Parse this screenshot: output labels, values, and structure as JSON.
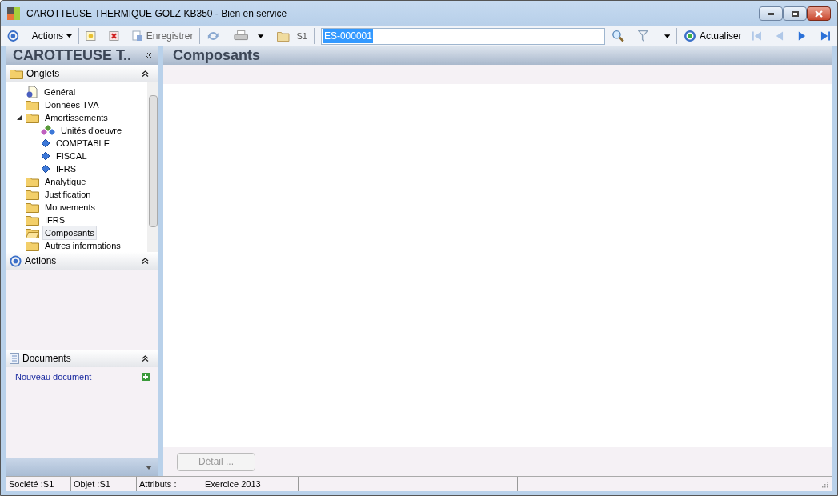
{
  "window": {
    "title": "CAROTTEUSE THERMIQUE GOLZ KB350 -  Bien en service"
  },
  "toolbar": {
    "actions": "Actions",
    "save": "Enregistrer",
    "folder": "S1",
    "search_value": "ES-000001",
    "refresh": "Actualiser"
  },
  "sidebar": {
    "title": "CAROTTEUSE T..",
    "tabs_panel": {
      "title": "Onglets",
      "expanded": true,
      "items": [
        {
          "label": "Général",
          "kind": "page",
          "selected": false
        },
        {
          "label": "Données TVA",
          "kind": "folder",
          "selected": false
        },
        {
          "label": "Amortissements",
          "kind": "folder",
          "selected": false,
          "expanded": true,
          "children": [
            {
              "label": "Unités d'oeuvre",
              "kind": "multi",
              "selected": false
            },
            {
              "label": "COMPTABLE",
              "kind": "diamond",
              "selected": false
            },
            {
              "label": "FISCAL",
              "kind": "diamond",
              "selected": false
            },
            {
              "label": "IFRS",
              "kind": "diamond",
              "selected": false
            }
          ]
        },
        {
          "label": "Analytique",
          "kind": "folder",
          "selected": false
        },
        {
          "label": "Justification",
          "kind": "folder",
          "selected": false
        },
        {
          "label": "Mouvements",
          "kind": "folder",
          "selected": false
        },
        {
          "label": "IFRS",
          "kind": "folder",
          "selected": false
        },
        {
          "label": "Composants",
          "kind": "folder",
          "selected": true
        },
        {
          "label": "Autres informations",
          "kind": "folder",
          "selected": false
        }
      ]
    },
    "actions_panel": {
      "title": "Actions",
      "expanded": true
    },
    "documents_panel": {
      "title": "Documents",
      "expanded": true,
      "link": "Nouveau document"
    }
  },
  "content": {
    "title": "Composants",
    "detail_button": {
      "label": "Détail ...",
      "disabled": true
    }
  },
  "status_bar": [
    "Société :S1",
    "Objet :S1",
    "Attributs :",
    "Exercice 2013"
  ]
}
